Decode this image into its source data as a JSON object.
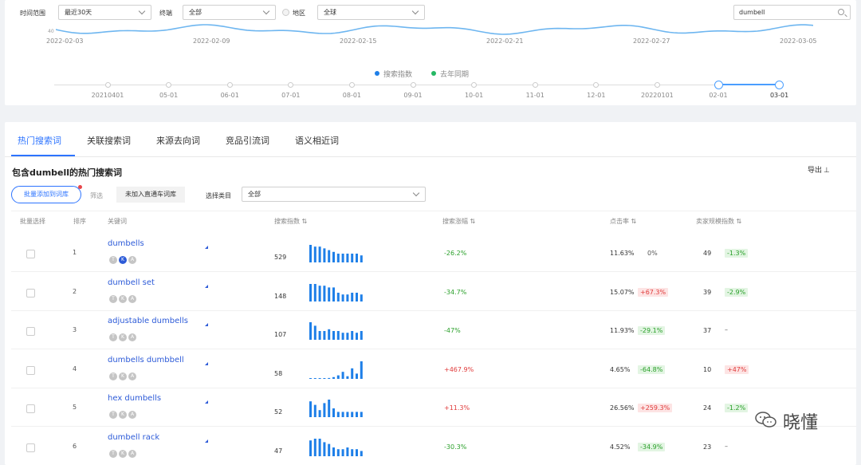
{
  "filters": {
    "time_label": "时间范围",
    "time_value": "最近30天",
    "terminal_label": "终端",
    "terminal_value": "全部",
    "region_label": "地区",
    "region_value": "全球",
    "search_value": "dumbell"
  },
  "trend_chart": {
    "y_label_top": "40",
    "x_ticks": [
      "2022-02-03",
      "2022-02-09",
      "2022-02-15",
      "2022-02-21",
      "2022-02-27",
      "2022-03-05"
    ],
    "legend": [
      {
        "name": "搜索指数",
        "color": "#1e7fe8"
      },
      {
        "name": "去年同期",
        "color": "#25b864"
      }
    ],
    "line_color": "#6eb6f0"
  },
  "timeline": {
    "labels": [
      "20210401",
      "05-01",
      "06-01",
      "07-01",
      "08-01",
      "09-01",
      "10-01",
      "11-01",
      "12-01",
      "20220101",
      "02-01",
      "03-01"
    ]
  },
  "tabs": [
    "热门搜索词",
    "关联搜索词",
    "来源去向词",
    "竞品引流词",
    "语义相近词"
  ],
  "section": {
    "title": "包含dumbell的热门搜索词",
    "export_label": "导出",
    "batch_add_label": "批量添加到词库",
    "filter_label": "筛选",
    "filter_chip": "未加入直通车词库",
    "category_label": "选择类目",
    "category_value": "全部"
  },
  "table": {
    "headers": [
      "批量选择",
      "排序",
      "关键词",
      "搜索指数 ⇅",
      "搜索涨幅 ⇅",
      "点击率 ⇅",
      "卖家规模指数 ⇅"
    ],
    "rows": [
      {
        "rank": "1",
        "keyword": "dumbells",
        "badges": [
          "T",
          "K",
          "A"
        ],
        "badge_on": [
          false,
          true,
          false
        ],
        "search_index": "529",
        "spark": [
          10,
          9,
          9,
          8,
          7,
          6,
          5,
          5,
          5,
          5,
          5,
          4
        ],
        "growth": "-26.2%",
        "growth_color": "green",
        "ctr": "11.63%",
        "ctr_change": "0%",
        "ctr_change_type": "none",
        "seller": "49",
        "seller_change": "-1.3%",
        "seller_change_type": "g"
      },
      {
        "rank": "2",
        "keyword": "dumbell set",
        "badges": [
          "T",
          "K",
          "A"
        ],
        "badge_on": [
          false,
          false,
          false
        ],
        "search_index": "148",
        "spark": [
          10,
          10,
          9,
          9,
          8,
          8,
          5,
          4,
          4,
          5,
          5,
          4
        ],
        "growth": "-34.7%",
        "growth_color": "green",
        "ctr": "15.07%",
        "ctr_change": "+67.3%",
        "ctr_change_type": "r",
        "seller": "39",
        "seller_change": "-2.9%",
        "seller_change_type": "g"
      },
      {
        "rank": "3",
        "keyword": "adjustable dumbells",
        "badges": [
          "T",
          "K",
          "A"
        ],
        "badge_on": [
          false,
          false,
          false
        ],
        "search_index": "107",
        "spark": [
          10,
          8,
          5,
          5,
          6,
          5,
          5,
          4,
          4,
          5,
          4,
          5
        ],
        "growth": "-47%",
        "growth_color": "green",
        "ctr": "11.93%",
        "ctr_change": "-29.1%",
        "ctr_change_type": "g",
        "seller": "37",
        "seller_change": "–",
        "seller_change_type": "none"
      },
      {
        "rank": "4",
        "keyword": "dumbells dumbbell",
        "badges": [
          "T",
          "K",
          "A"
        ],
        "badge_on": [
          false,
          false,
          false
        ],
        "search_index": "58",
        "spark": [
          0.3,
          0.3,
          0.3,
          0.3,
          0.5,
          1,
          2,
          4,
          1.5,
          6,
          3,
          10
        ],
        "growth": "+467.9%",
        "growth_color": "red",
        "ctr": "4.65%",
        "ctr_change": "-64.8%",
        "ctr_change_type": "g",
        "seller": "10",
        "seller_change": "+47%",
        "seller_change_type": "r"
      },
      {
        "rank": "5",
        "keyword": "hex dumbells",
        "badges": [
          "T",
          "K",
          "A"
        ],
        "badge_on": [
          false,
          false,
          false
        ],
        "search_index": "52",
        "spark": [
          9,
          7,
          4,
          8,
          10,
          5,
          3,
          3,
          3,
          3,
          3,
          3
        ],
        "growth": "+11.3%",
        "growth_color": "red",
        "ctr": "26.56%",
        "ctr_change": "+259.3%",
        "ctr_change_type": "r",
        "seller": "24",
        "seller_change": "-1.2%",
        "seller_change_type": "g"
      },
      {
        "rank": "6",
        "keyword": "dumbell rack",
        "badges": [
          "T",
          "K",
          "A"
        ],
        "badge_on": [
          false,
          false,
          false
        ],
        "search_index": "47",
        "spark": [
          9,
          10,
          10,
          8,
          7,
          5,
          4,
          4,
          5,
          4,
          4,
          3
        ],
        "growth": "-30.3%",
        "growth_color": "green",
        "ctr": "4.52%",
        "ctr_change": "-34.9%",
        "ctr_change_type": "g",
        "seller": "23",
        "seller_change": "–",
        "seller_change_type": "none"
      }
    ]
  },
  "watermark": "晓懂"
}
